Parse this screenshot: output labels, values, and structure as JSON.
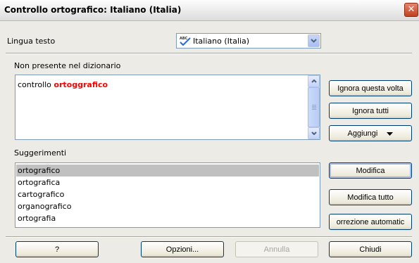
{
  "window": {
    "title": "Controllo ortografico: Italiano (Italia)",
    "close_glyph": "✕"
  },
  "language": {
    "label": "Lingua testo",
    "value": "Italiano (Italia)",
    "icon": "abc-spellcheck-icon"
  },
  "not_in_dictionary": {
    "label": "Non presente nel dizionario",
    "text_before": "controllo",
    "misspelled_word": "ortoggrafico"
  },
  "suggestions": {
    "label": "Suggerimenti",
    "items": [
      "ortografico",
      "ortografica",
      "cartografico",
      "organografico",
      "ortografia"
    ],
    "selected_index": 0
  },
  "buttons": {
    "ignore_once": "Ignora questa volta",
    "ignore_all": "Ignora tutti",
    "add": "Aggiungi",
    "change": "Modifica",
    "change_all": "Modifica tutto",
    "autocorrect": "orrezione automatic",
    "help": "?",
    "options": "Opzioni...",
    "cancel": "Annulla",
    "close": "Chiudi"
  },
  "colors": {
    "misspelled": "#ff0000",
    "dialog_bg": "#ecebe5",
    "selection": "#c0c0c0"
  }
}
